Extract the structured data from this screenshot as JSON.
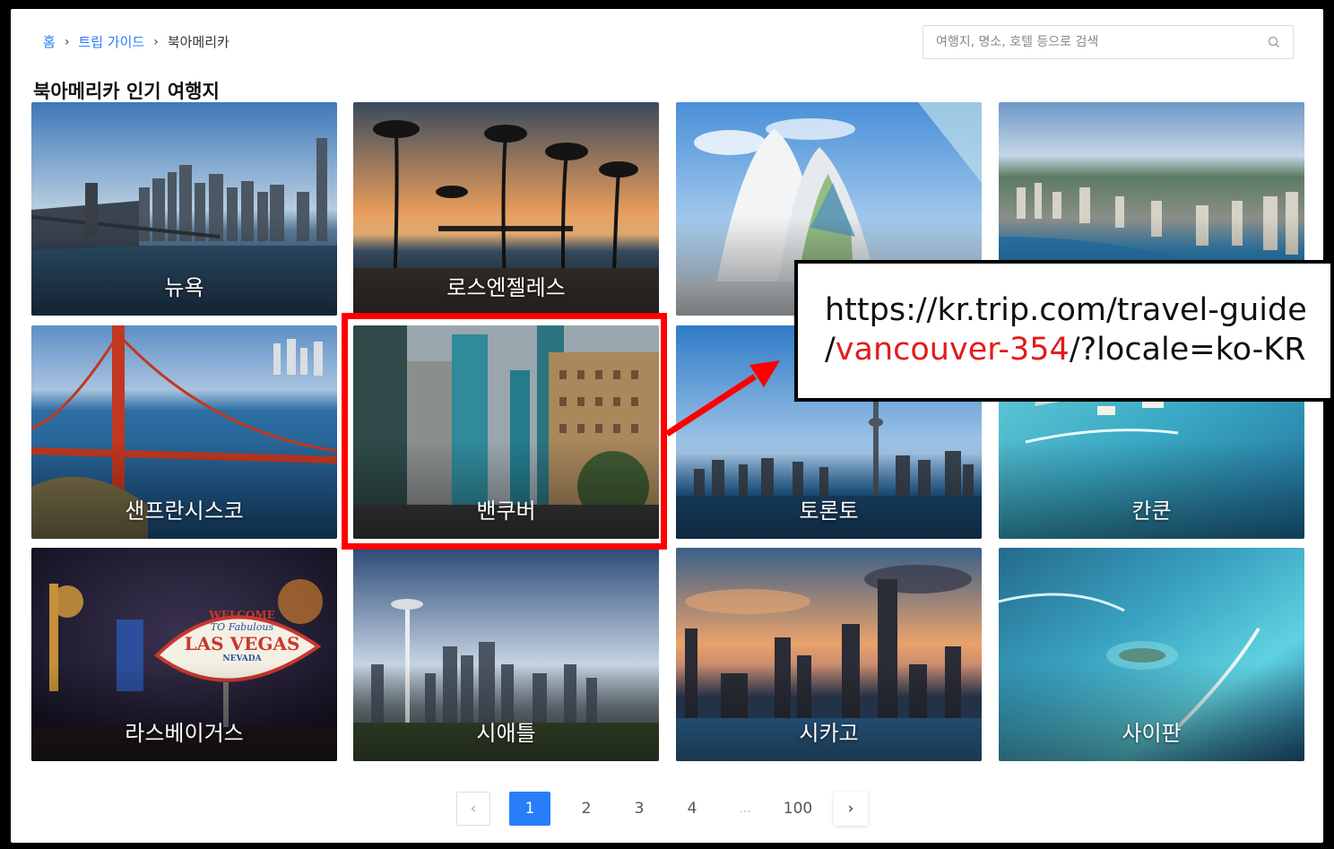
{
  "breadcrumb": {
    "home": "홈",
    "sep1": "›",
    "guide": "트립 가이드",
    "sep2": "›",
    "current": "북아메리카"
  },
  "search": {
    "placeholder": "여행지, 명소, 호텔 등으로 검색",
    "icon": "search-icon"
  },
  "section_title": "북아메리카 인기 여행지",
  "destinations": [
    {
      "name": "뉴욕"
    },
    {
      "name": "로스엔젤레스"
    },
    {
      "name": ""
    },
    {
      "name": ""
    },
    {
      "name": "샌프란시스코"
    },
    {
      "name": "밴쿠버"
    },
    {
      "name": "토론토"
    },
    {
      "name": "칸쿤"
    },
    {
      "name": "라스베이거스"
    },
    {
      "name": "시애틀"
    },
    {
      "name": "시카고"
    },
    {
      "name": "사이판"
    }
  ],
  "las_vegas_sign": {
    "welcome": "WELCOME",
    "to": "TO Fabulous",
    "city": "LAS VEGAS",
    "state": "NEVADA"
  },
  "pagination": {
    "prev": "‹",
    "pages": [
      "1",
      "2",
      "3",
      "4"
    ],
    "ellipsis": "...",
    "last": "100",
    "next": "›",
    "active": "1"
  },
  "annotation": {
    "url_line1": "https://kr.trip.com/travel-guide",
    "url_line2_prefix": "/",
    "url_line2_highlight": "vancouver-354",
    "url_line2_suffix": "/?locale=ko-KR",
    "highlight_color": "#ff0000",
    "text_highlight_color": "#e31b1b"
  },
  "colors": {
    "link_blue": "#287dfa",
    "active_page": "#287dfa"
  }
}
